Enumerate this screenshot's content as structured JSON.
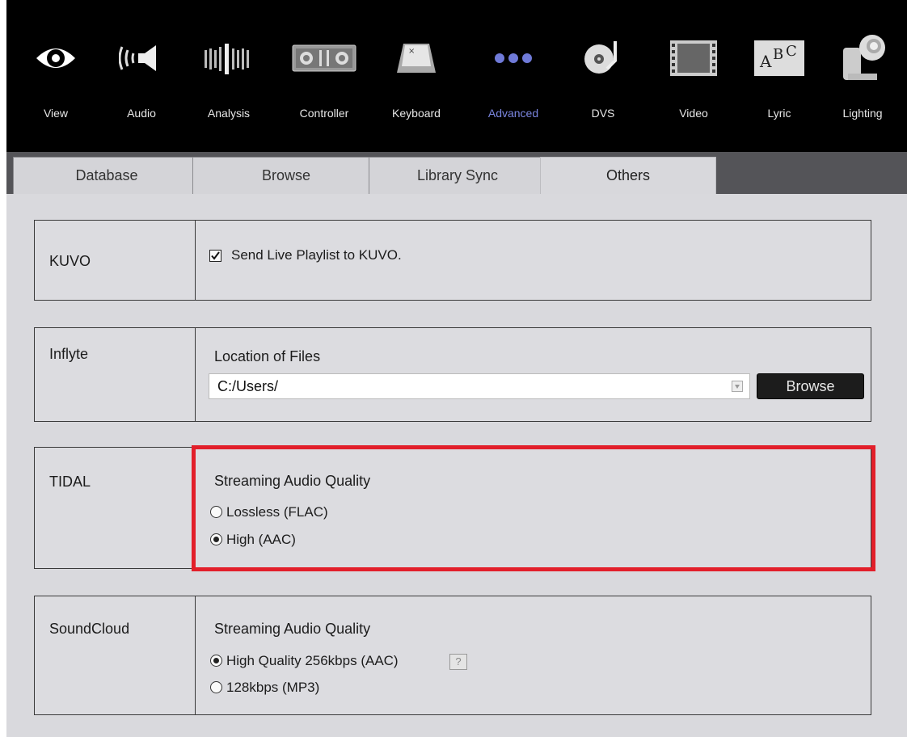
{
  "toolbar": {
    "items": [
      {
        "label": "View",
        "icon": "eye-icon"
      },
      {
        "label": "Audio",
        "icon": "speaker-icon"
      },
      {
        "label": "Analysis",
        "icon": "waveform-bars-icon"
      },
      {
        "label": "Controller",
        "icon": "controller-icon"
      },
      {
        "label": "Keyboard",
        "icon": "keyboard-key-icon"
      },
      {
        "label": "Advanced",
        "icon": "three-dots-icon"
      },
      {
        "label": "DVS",
        "icon": "turntable-icon"
      },
      {
        "label": "Video",
        "icon": "film-strip-icon"
      },
      {
        "label": "Lyric",
        "icon": "abc-icon"
      },
      {
        "label": "Lighting",
        "icon": "lighting-fixture-icon"
      }
    ],
    "active": "Advanced",
    "active_color": "#7b86e0"
  },
  "tabs": {
    "items": [
      "Database",
      "Browse",
      "Library Sync",
      "Others"
    ],
    "active": "Others"
  },
  "kuvo": {
    "name": "KUVO",
    "checkbox_label": "Send Live Playlist to KUVO.",
    "checked": true
  },
  "inflyte": {
    "name": "Inflyte",
    "location_label": "Location of Files",
    "path_value": "C:/Users/",
    "browse_label": "Browse"
  },
  "tidal": {
    "name": "TIDAL",
    "quality_label": "Streaming Audio Quality",
    "options": [
      "Lossless (FLAC)",
      "High (AAC)"
    ],
    "selected": "High (AAC)"
  },
  "soundcloud": {
    "name": "SoundCloud",
    "quality_label": "Streaming Audio Quality",
    "options": [
      "High Quality 256kbps (AAC)",
      "128kbps (MP3)"
    ],
    "selected": "High Quality 256kbps (AAC)",
    "help_label": "?"
  },
  "colors": {
    "highlight": "#e21f2a",
    "toolbar_bg": "#000000",
    "panel_bg": "#d9d9dd"
  }
}
